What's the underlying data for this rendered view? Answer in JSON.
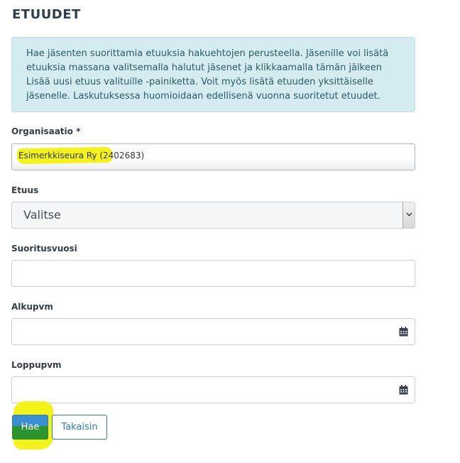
{
  "page": {
    "title": "ETUUDET"
  },
  "info": {
    "lines": [
      "Hae jäsenten suorittamia etuuksia hakuehtojen perusteella. Jäsenille voi lisätä",
      "etuuksia massana valitsemalla halutut jäsenet ja klikkaamalla tämän jälkeen",
      "Lisää uusi etuus valituille -painiketta. Voit myös lisätä etuuden yksittäiselle",
      "jäsenelle. Laskutuksessa huomioidaan edellisenä vuonna suoritetut etuudet."
    ]
  },
  "form": {
    "organisation": {
      "label": "Organisaatio *",
      "value": "Esimerkkiseura Ry (2402683)"
    },
    "benefit": {
      "label": "Etuus",
      "value": "Valitse"
    },
    "year": {
      "label": "Suoritusvuosi",
      "value": ""
    },
    "start": {
      "label": "Alkupvm",
      "value": "",
      "icon": "calendar-icon"
    },
    "end": {
      "label": "Loppupvm",
      "value": "",
      "icon": "calendar-icon"
    }
  },
  "buttons": {
    "search": "Hae",
    "back": "Takaisin"
  },
  "colors": {
    "highlight": "#f3f31a",
    "primary": "#3a8fd1",
    "info_bg": "#d4ecf0"
  }
}
